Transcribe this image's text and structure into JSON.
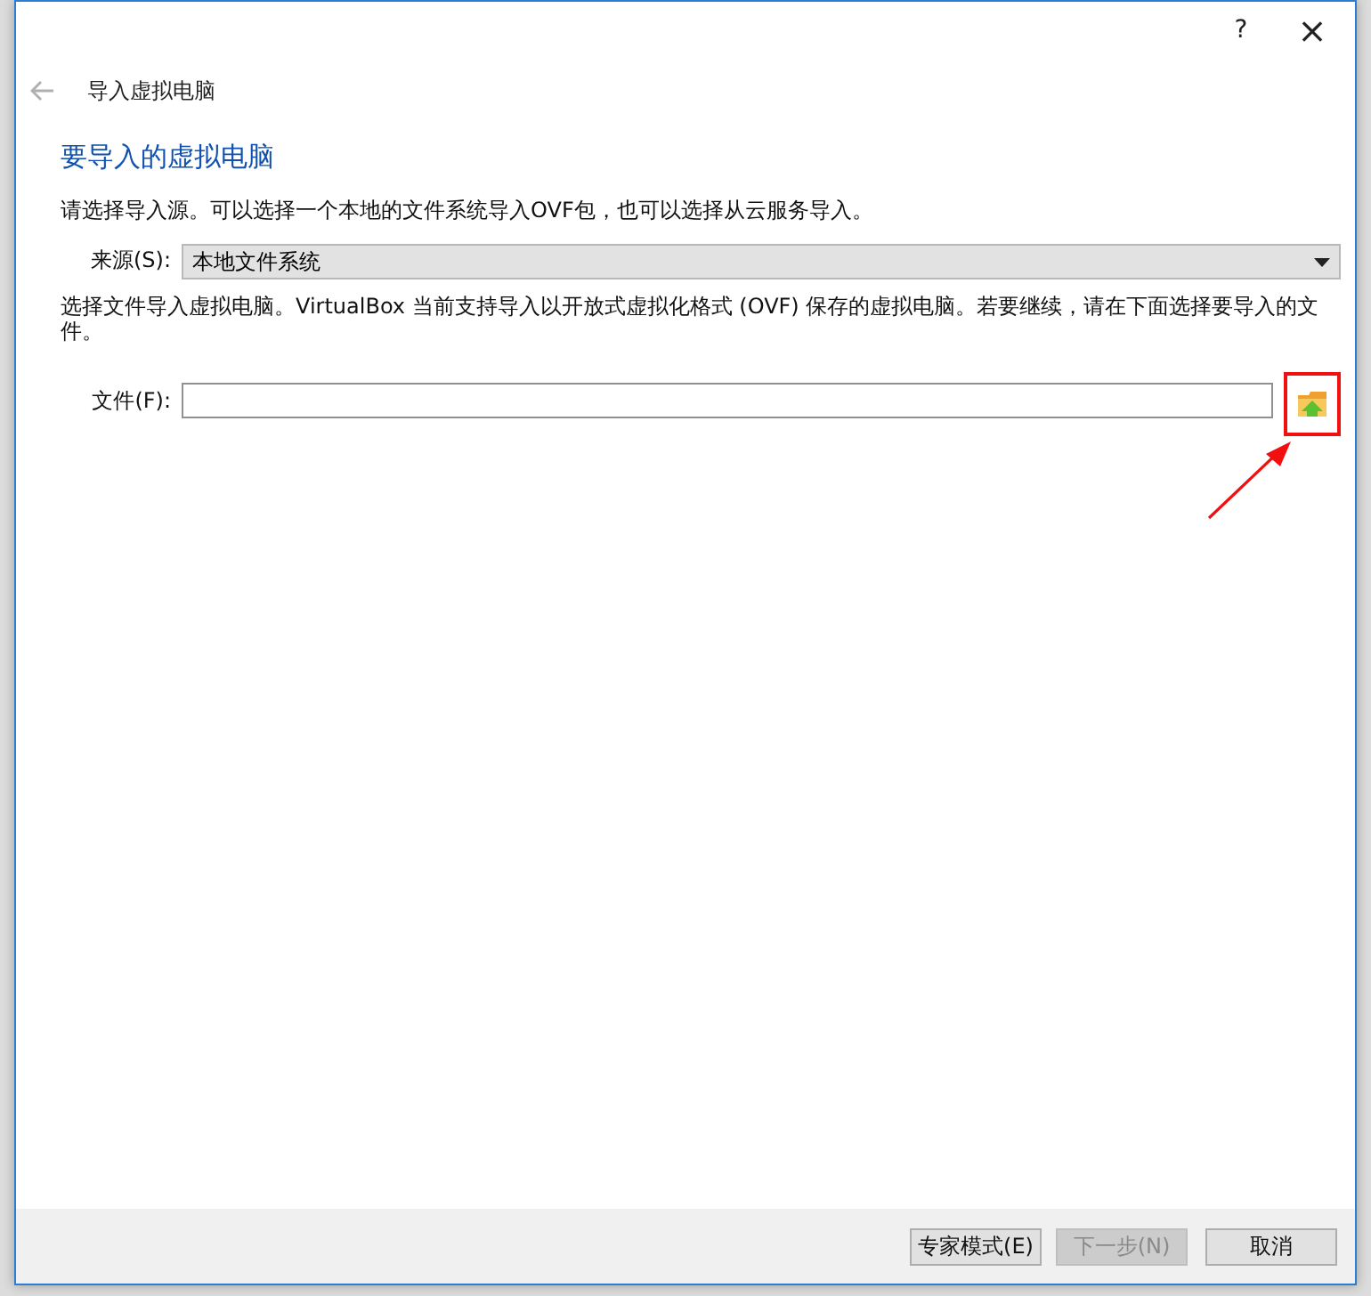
{
  "window": {
    "help": "?",
    "close": "×"
  },
  "header": {
    "title": "导入虚拟电脑"
  },
  "page": {
    "heading": "要导入的虚拟电脑",
    "intro": "请选择导入源。可以选择一个本地的文件系统导入OVF包，也可以选择从云服务导入。",
    "source": {
      "label": "来源(S):",
      "value": "本地文件系统"
    },
    "description": "选择文件导入虚拟电脑。VirtualBox 当前支持导入以开放式虚拟化格式 (OVF) 保存的虚拟电脑。若要继续，请在下面选择要导入的文件。",
    "file": {
      "label": "文件(F):"
    },
    "annotation": {
      "highlight": true
    }
  },
  "buttons": [
    {
      "label": "专家模式(E)",
      "disabled": false
    },
    {
      "label": "下一步(N)",
      "disabled": true
    },
    {
      "label": "取消",
      "disabled": false
    }
  ]
}
